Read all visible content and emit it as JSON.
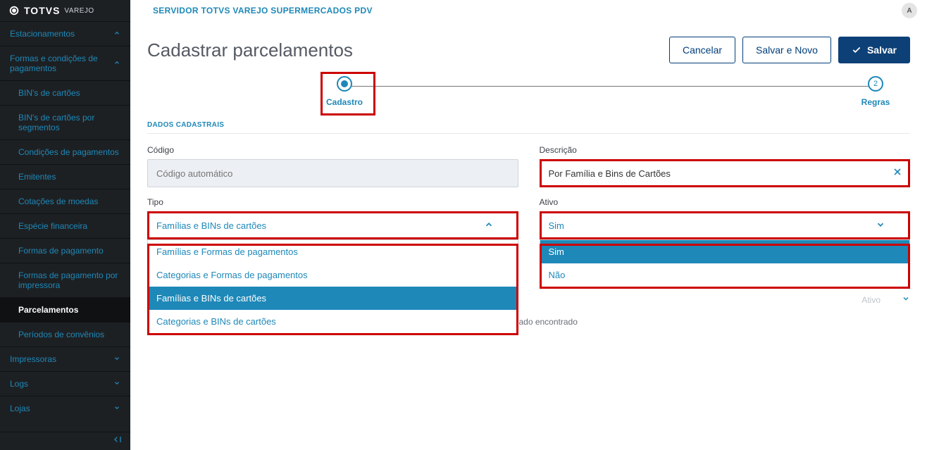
{
  "brand": {
    "name": "TOTVS",
    "sub": "VAREJO"
  },
  "topbar": {
    "title": "SERVIDOR TOTVS VAREJO SUPERMERCADOS PDV",
    "avatar_initial": "A"
  },
  "sidebar": {
    "items": [
      {
        "label": "Estacionamentos"
      },
      {
        "label": "Formas e condições de pagamentos"
      },
      {
        "label": "BIN's de cartões"
      },
      {
        "label": "BIN's de cartões por segmentos"
      },
      {
        "label": "Condições de pagamentos"
      },
      {
        "label": "Emitentes"
      },
      {
        "label": "Cotações de moedas"
      },
      {
        "label": "Espécie financeira"
      },
      {
        "label": "Formas de pagamento"
      },
      {
        "label": "Formas de pagamento por impressora"
      },
      {
        "label": "Parcelamentos"
      },
      {
        "label": "Períodos de convênios"
      },
      {
        "label": "Impressoras"
      },
      {
        "label": "Logs"
      },
      {
        "label": "Lojas"
      }
    ]
  },
  "page": {
    "title": "Cadastrar parcelamentos"
  },
  "actions": {
    "cancel": "Cancelar",
    "save_new": "Salvar e Novo",
    "save": "Salvar"
  },
  "stepper": {
    "step1": {
      "label": "Cadastro"
    },
    "step2": {
      "num": "2",
      "label": "Regras"
    }
  },
  "section": "DADOS CADASTRAIS",
  "fields": {
    "codigo": {
      "label": "Código",
      "placeholder": "Código automático",
      "value": ""
    },
    "descricao": {
      "label": "Descrição",
      "value": "Por Família e Bins de Cartões"
    },
    "tipo": {
      "label": "Tipo",
      "value": "Famílias e BINs de cartões",
      "options": [
        "Famílias e Formas de pagamentos",
        "Categorias e Formas de pagamentos",
        "Famílias e BINs de cartões",
        "Categorias e BINs de cartões"
      ]
    },
    "ativo": {
      "label": "Ativo",
      "value": "Sim",
      "options": [
        "Sim",
        "Não"
      ]
    }
  },
  "ghost_header": {
    "left": "...",
    "right": "Ativo"
  },
  "empty_message": "Nenhum dado encontrado"
}
